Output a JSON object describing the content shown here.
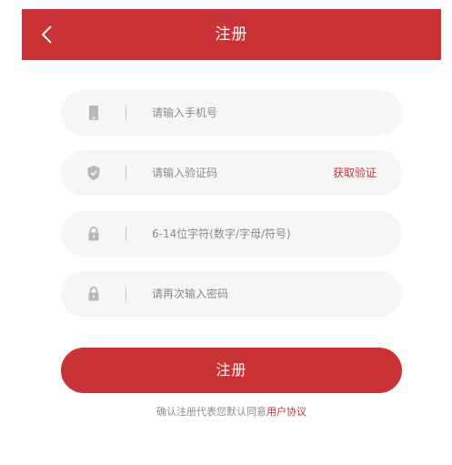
{
  "header": {
    "title": "注册",
    "back_icon": "chevron-left-icon",
    "background": "#c93236"
  },
  "form": {
    "phone": {
      "placeholder": "请输入手机号",
      "icon": "phone-icon"
    },
    "code": {
      "placeholder": "请输入验证码",
      "icon": "shield-check-icon",
      "action_label": "获取验证"
    },
    "password": {
      "placeholder": "6-14位字符(数字/字母/符号)",
      "icon": "lock-icon"
    },
    "confirm_password": {
      "placeholder": "请再次输入密码",
      "icon": "lock-icon"
    }
  },
  "submit": {
    "label": "注册"
  },
  "agreement": {
    "prefix": "确认注册代表您默认同意",
    "link_label": "用户协议"
  },
  "colors": {
    "accent": "#c93236",
    "field_bg": "#f6f6f6",
    "icon_gray": "#b8b8b8",
    "placeholder": "#8a8a8a"
  }
}
